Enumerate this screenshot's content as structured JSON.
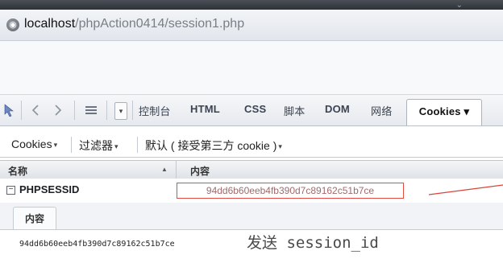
{
  "address_bar": {
    "host": "localhost",
    "path": "/phpAction0414/session1.php"
  },
  "toolbar": {
    "dropdown_glyph": "▾",
    "tabs": [
      {
        "label": "控制台"
      },
      {
        "label": "HTML"
      },
      {
        "label": "CSS"
      },
      {
        "label": "脚本"
      },
      {
        "label": "DOM"
      },
      {
        "label": "网络"
      },
      {
        "label": "Cookies ▾"
      }
    ],
    "active_tab": "Cookies"
  },
  "menu": {
    "cookies": "Cookies",
    "filter": "过滤器",
    "default_policy": "默认 ( 接受第三方 cookie )",
    "caret": "▾"
  },
  "table": {
    "headers": {
      "name": "名称",
      "sort_indicator": "▲",
      "content": "内容"
    },
    "rows": [
      {
        "expander": "−",
        "name": "PHPSESSID",
        "value": "94dd6b60eeb4fb390d7c89162c51b7ce"
      }
    ]
  },
  "detail": {
    "tab_label": "内容",
    "value": "94dd6b60eeb4fb390d7c89162c51b7ce"
  },
  "annotation": {
    "text": "发送 session_id",
    "color": "#4a4a4a"
  },
  "colors": {
    "highlight_border": "#e24d43",
    "toolbar_bg": "#e6e9ee"
  },
  "icons": {
    "firebug": "firebug-icon",
    "back": "chevron-left-icon",
    "forward": "chevron-right-icon",
    "menu": "list-icon",
    "site": "globe-icon"
  }
}
